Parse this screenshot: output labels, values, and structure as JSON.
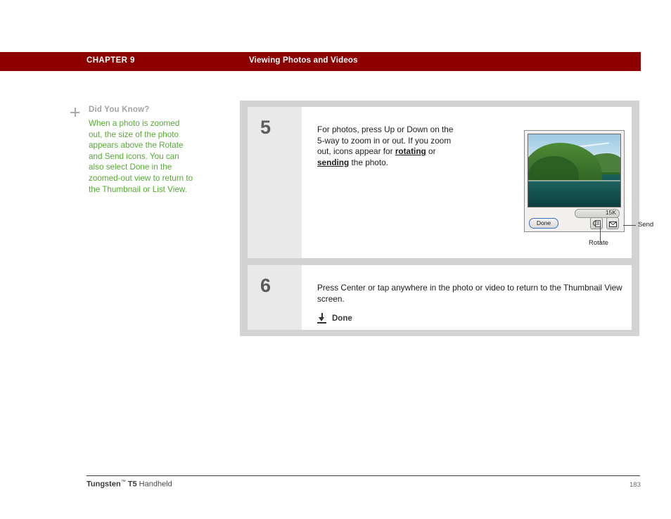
{
  "header": {
    "chapter": "CHAPTER 9",
    "title": "Viewing Photos and Videos",
    "bar_color": "#8e0000"
  },
  "sidenote": {
    "plus_icon": "plus-icon",
    "heading": "Did You Know?",
    "body": "When a photo is zoomed out, the size of the photo appears above the Rotate and Send icons. You can also select Done in the zoomed-out view to return to the Thumbnail or List View.",
    "text_color": "#55aa33",
    "heading_color": "#a3a3a3"
  },
  "steps": [
    {
      "number": "5",
      "text_before": "For photos, press Up or Down on the 5-way to zoom in or out. If you zoom out, icons appear for ",
      "emphasis_1": "rotating",
      "text_mid": " or ",
      "emphasis_2": "sending",
      "text_after": " the photo."
    },
    {
      "number": "6",
      "text": "Press Center or tap anywhere in the photo or video to return to the Thumbnail View screen.",
      "done_icon": "download-arrow-icon",
      "done_label": "Done"
    }
  ],
  "device": {
    "photo_alt": "landscape-photo-forested-hill-over-water",
    "size_badge": "15K",
    "done_button": "Done",
    "rotate_icon": "rotate-icon",
    "send_icon": "envelope-send-icon"
  },
  "callouts": {
    "send": "Send",
    "rotate": "Rotate"
  },
  "footer": {
    "product": "Tungsten",
    "trademark": "™",
    "model": " T5",
    "suffix": " Handheld",
    "page": "183"
  }
}
